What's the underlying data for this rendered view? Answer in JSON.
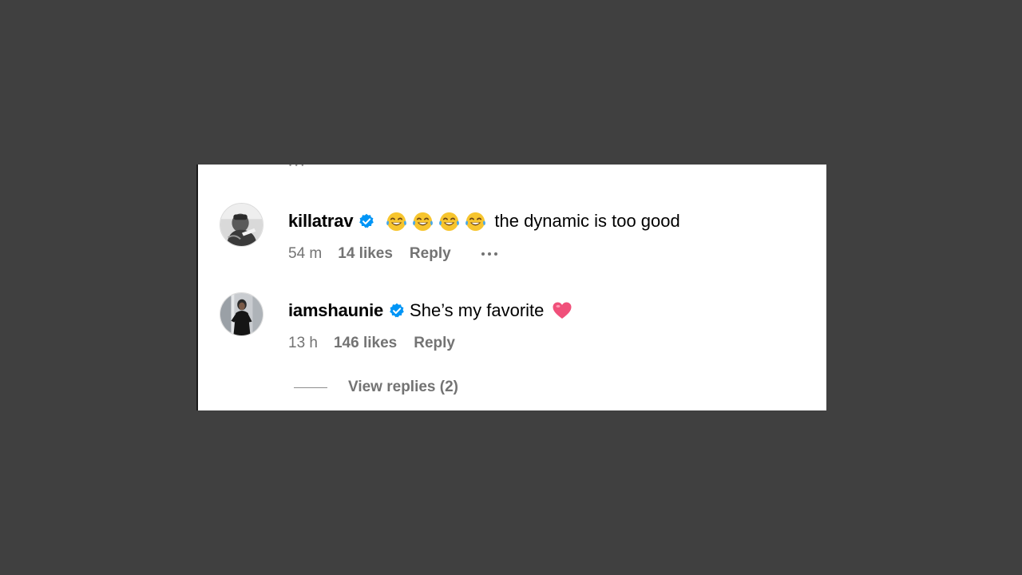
{
  "clipped_remnant": "• • •",
  "comments": [
    {
      "username": "killatrav",
      "verified": true,
      "emojis": [
        "face-with-tears-of-joy",
        "face-with-tears-of-joy",
        "face-with-tears-of-joy",
        "face-with-tears-of-joy"
      ],
      "text": "the dynamic is too good",
      "time": "54 m",
      "likes": "14 likes",
      "reply_label": "Reply",
      "has_more_menu": true
    },
    {
      "username": "iamshaunie",
      "verified": true,
      "text": "She’s my favorite",
      "trailing_emoji": "pink-heart",
      "time": "13 h",
      "likes": "146 likes",
      "reply_label": "Reply"
    }
  ],
  "view_replies_label": "View replies (2)",
  "colors": {
    "background": "#404040",
    "card": "#ffffff",
    "meta_text": "#737373",
    "verified_blue": "#0095f6",
    "heart_pink": "#f0507a"
  }
}
